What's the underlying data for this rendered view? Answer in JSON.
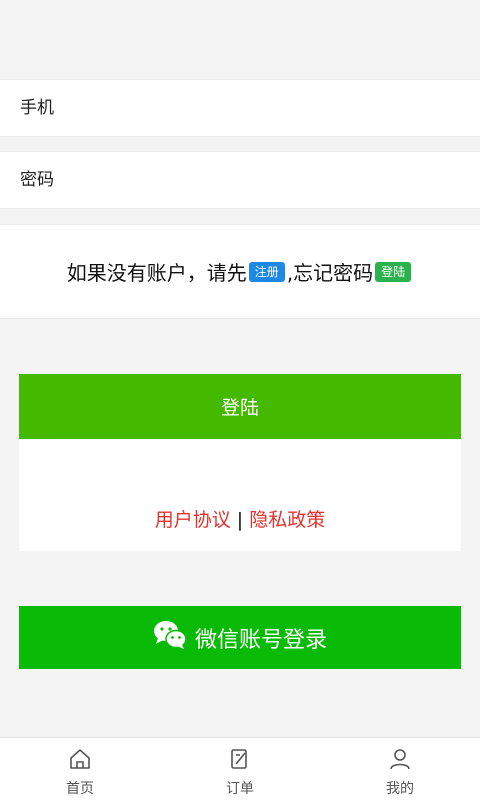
{
  "form": {
    "phone_placeholder": "手机",
    "password_placeholder": "密码"
  },
  "hint": {
    "prefix": "如果没有账户，请先",
    "register_label": "注册",
    "middle": ",忘记密码",
    "login_tag_label": "登陆"
  },
  "login_button": "登陆",
  "agreement": {
    "user_agreement": "用户协议",
    "separator": " | ",
    "privacy_policy": "隐私政策"
  },
  "wechat_button": "微信账号登录",
  "tabbar": {
    "items": [
      {
        "label": "首页",
        "icon": "home-icon"
      },
      {
        "label": "订单",
        "icon": "order-icon"
      },
      {
        "label": "我的",
        "icon": "user-icon"
      }
    ]
  },
  "colors": {
    "login_green": "#44b900",
    "wechat_green": "#09bb07",
    "link_red": "#e5322d",
    "tag_blue": "#1e88e5"
  }
}
